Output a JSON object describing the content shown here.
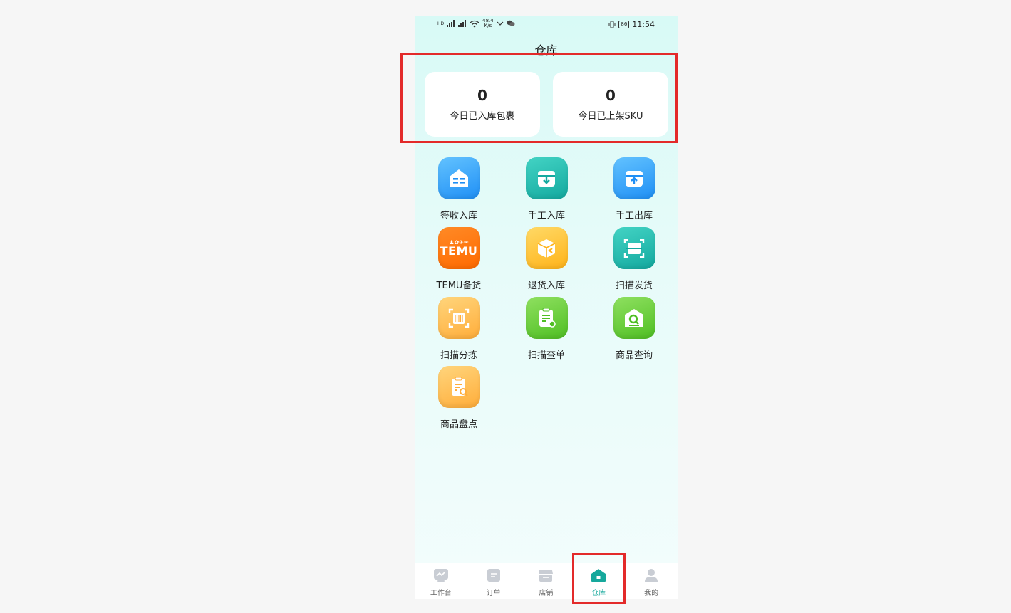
{
  "status_bar": {
    "network_left": "HD",
    "speed_value": "48.4",
    "speed_unit": "K/s",
    "battery": "86",
    "time": "11:54"
  },
  "page_title": "仓库",
  "stats": [
    {
      "value": "0",
      "label": "今日已入库包裹"
    },
    {
      "value": "0",
      "label": "今日已上架SKU"
    }
  ],
  "functions": [
    {
      "label": "签收入库",
      "icon": "warehouse-checkin-icon",
      "color": "blue"
    },
    {
      "label": "手工入库",
      "icon": "box-inbound-icon",
      "color": "teal"
    },
    {
      "label": "手工出库",
      "icon": "box-outbound-icon",
      "color": "blue"
    },
    {
      "label": "TEMU备货",
      "icon": "temu-logo-icon",
      "color": "orange",
      "logo_text": "TEMU"
    },
    {
      "label": "退货入库",
      "icon": "return-box-icon",
      "color": "yellow"
    },
    {
      "label": "扫描发货",
      "icon": "scan-ship-icon",
      "color": "teal"
    },
    {
      "label": "扫描分拣",
      "icon": "scan-barcode-icon",
      "color": "peach"
    },
    {
      "label": "扫描查单",
      "icon": "scan-document-icon",
      "color": "green"
    },
    {
      "label": "商品查询",
      "icon": "product-search-icon",
      "color": "green"
    },
    {
      "label": "商品盘点",
      "icon": "inventory-check-icon",
      "color": "peach"
    }
  ],
  "tabbar": [
    {
      "label": "工作台",
      "icon": "dashboard-icon",
      "active": false
    },
    {
      "label": "订单",
      "icon": "order-icon",
      "active": false
    },
    {
      "label": "店铺",
      "icon": "store-icon",
      "active": false
    },
    {
      "label": "仓库",
      "icon": "warehouse-icon",
      "active": true
    },
    {
      "label": "我的",
      "icon": "profile-icon",
      "active": false
    }
  ],
  "colors": {
    "accent": "#16a89c",
    "highlight": "#e32a2a",
    "background": "#d8faf6"
  }
}
